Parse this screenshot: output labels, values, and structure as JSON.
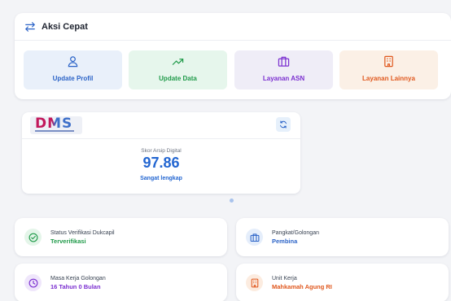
{
  "quick_actions": {
    "title": "Aksi Cepat",
    "items": [
      {
        "label": "Update Profil",
        "icon": "user-icon",
        "bg": "#e9f0fa",
        "color": "#2b63c7"
      },
      {
        "label": "Update Data",
        "icon": "trending-up-icon",
        "bg": "#e6f6ec",
        "color": "#1f9a49"
      },
      {
        "label": "Layanan ASN",
        "icon": "briefcase-icon",
        "bg": "#efedf7",
        "color": "#7b2fd0"
      },
      {
        "label": "Layanan Lainnya",
        "icon": "building-icon",
        "bg": "#fbf0e6",
        "color": "#e0581e"
      }
    ]
  },
  "dms": {
    "logo_text": "DMS",
    "score_label": "Skor Arsip Digital",
    "score_value": "97.86",
    "score_desc": "Sangat lengkap"
  },
  "info_cards": [
    {
      "label": "Status Verifikasi Dukcapil",
      "value": "Terverifikasi",
      "icon": "check-circle-icon",
      "color": "#1f9a49",
      "bg": "#e4f5e9"
    },
    {
      "label": "Pangkat/Golongan",
      "value": "Pembina",
      "icon": "briefcase-icon",
      "color": "#2b63c7",
      "bg": "#e5eefb"
    },
    {
      "label": "Masa Kerja Golongan",
      "value": "16 Tahun 0 Bulan",
      "icon": "clock-icon",
      "color": "#7b2fd0",
      "bg": "#efe6fb"
    },
    {
      "label": "Unit Kerja",
      "value": "Mahkamah Agung RI",
      "icon": "building-icon",
      "color": "#e0581e",
      "bg": "#fcece0"
    }
  ]
}
